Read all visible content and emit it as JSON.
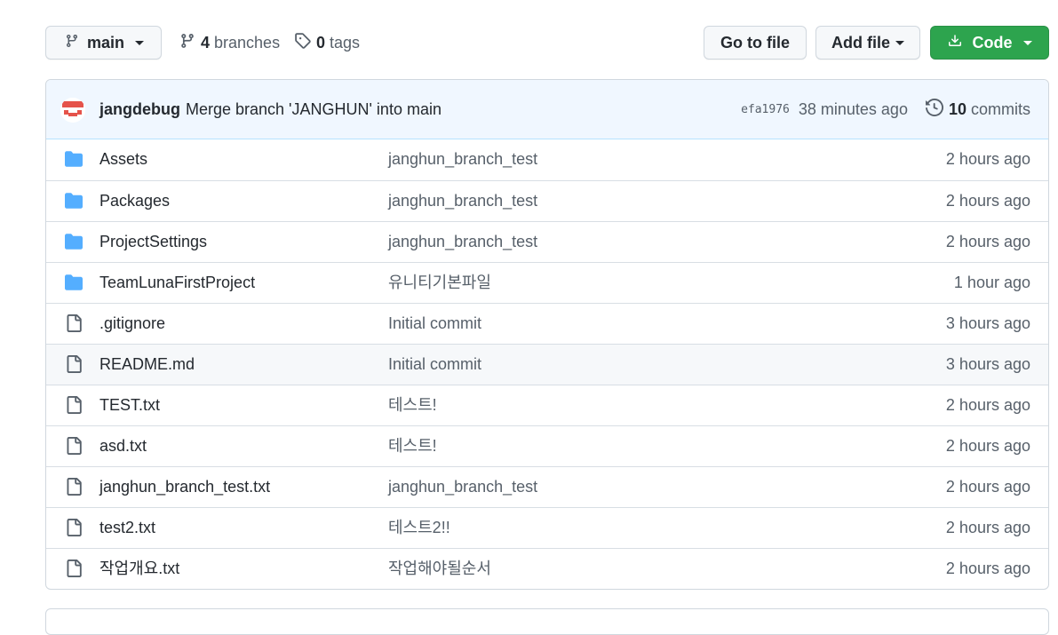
{
  "toolbar": {
    "branch_label": "main",
    "branches_count": "4",
    "branches_label": "branches",
    "tags_count": "0",
    "tags_label": "tags",
    "go_to_file_label": "Go to file",
    "add_file_label": "Add file",
    "code_label": "Code"
  },
  "commit": {
    "author": "jangdebug",
    "message": "Merge branch 'JANGHUN' into main",
    "sha": "efa1976",
    "time": "38 minutes ago",
    "commits_count": "10",
    "commits_label": "commits"
  },
  "files": [
    {
      "type": "folder",
      "name": "Assets",
      "message": "janghun_branch_test",
      "age": "2 hours ago"
    },
    {
      "type": "folder",
      "name": "Packages",
      "message": "janghun_branch_test",
      "age": "2 hours ago"
    },
    {
      "type": "folder",
      "name": "ProjectSettings",
      "message": "janghun_branch_test",
      "age": "2 hours ago"
    },
    {
      "type": "folder",
      "name": "TeamLunaFirstProject",
      "message": "유니티기본파일",
      "age": "1 hour ago"
    },
    {
      "type": "file",
      "name": ".gitignore",
      "message": "Initial commit",
      "age": "3 hours ago"
    },
    {
      "type": "file",
      "name": "README.md",
      "message": "Initial commit",
      "age": "3 hours ago"
    },
    {
      "type": "file",
      "name": "TEST.txt",
      "message": "테스트!",
      "age": "2 hours ago"
    },
    {
      "type": "file",
      "name": "asd.txt",
      "message": "테스트!",
      "age": "2 hours ago"
    },
    {
      "type": "file",
      "name": "janghun_branch_test.txt",
      "message": "janghun_branch_test",
      "age": "2 hours ago"
    },
    {
      "type": "file",
      "name": "test2.txt",
      "message": "테스트2!!",
      "age": "2 hours ago"
    },
    {
      "type": "file",
      "name": "작업개요.txt",
      "message": "작업해야될순서",
      "age": "2 hours ago"
    }
  ],
  "colors": {
    "accent_green": "#2da44e",
    "folder_blue": "#54aeff",
    "commit_bar_bg": "#f0f7ff"
  },
  "icons": {
    "branch": "git-branch-icon",
    "tag": "tag-icon",
    "download": "download-icon",
    "history": "history-icon",
    "folder": "folder-icon",
    "file": "file-icon"
  }
}
